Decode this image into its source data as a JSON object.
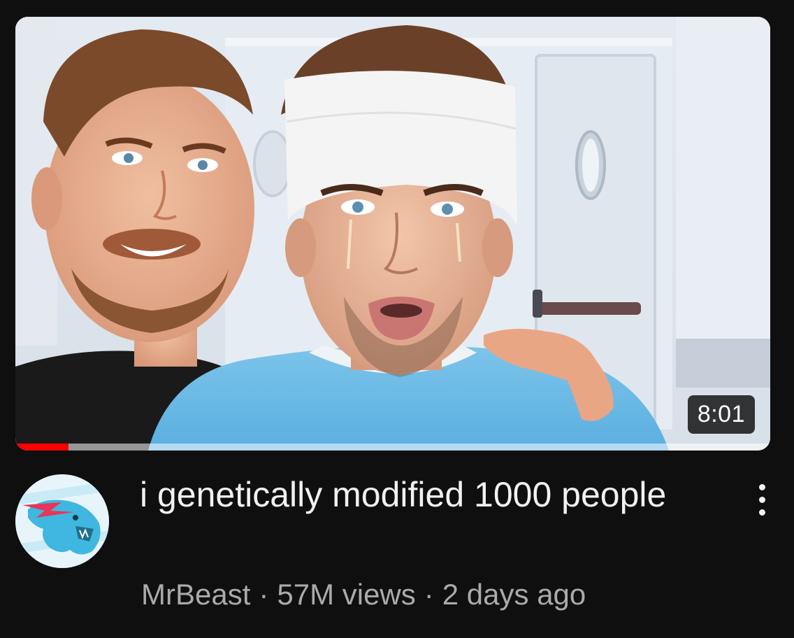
{
  "video": {
    "duration": "8:01",
    "progress_fraction": 0.07,
    "title": "i genetically modified 1000 people",
    "channel": "MrBeast",
    "views": "57M views",
    "age": "2 days ago",
    "separator": "·"
  },
  "icons": {
    "channel_avatar": "mrbeast-panther-logo",
    "more": "vertical-ellipsis-icon"
  },
  "colors": {
    "background": "#0f0f0f",
    "title_text": "#f1f1f1",
    "secondary_text": "#aaaaaa",
    "progress": "#ff0000",
    "avatar_brand": "#3fb7e0"
  }
}
